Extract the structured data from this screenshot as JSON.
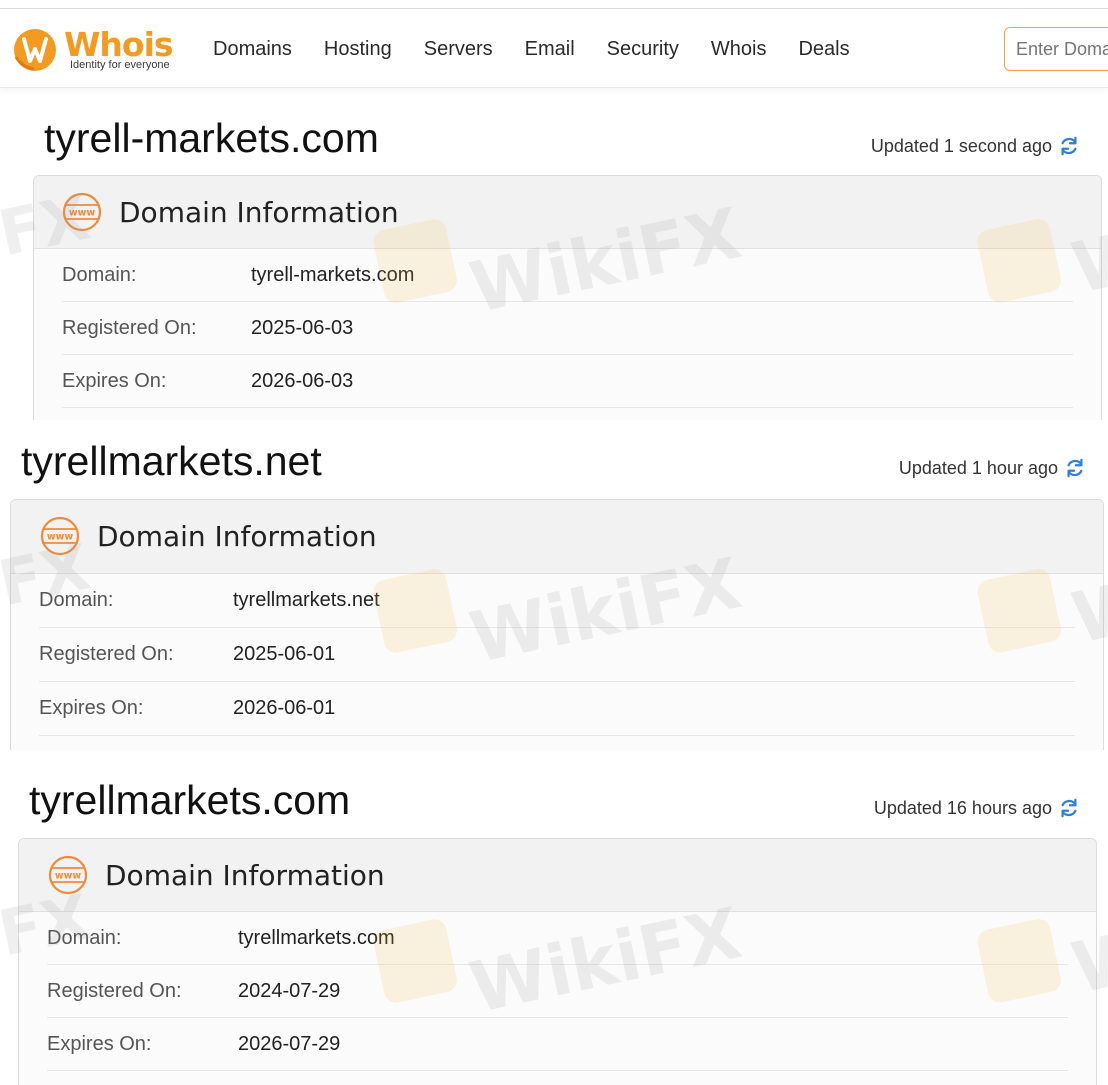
{
  "header": {
    "logo_word": "Whois",
    "logo_tagline": "Identity for everyone",
    "nav": [
      "Domains",
      "Hosting",
      "Servers",
      "Email",
      "Security",
      "Whois",
      "Deals"
    ],
    "search_placeholder": "Enter Domain"
  },
  "domains": [
    {
      "name": "tyrell-markets.com",
      "updated": "Updated 1 second ago",
      "card_title": "Domain Information",
      "rows": [
        {
          "label": "Domain:",
          "value": "tyrell-markets.com"
        },
        {
          "label": "Registered On:",
          "value": "2025-06-03"
        },
        {
          "label": "Expires On:",
          "value": "2026-06-03"
        }
      ]
    },
    {
      "name": "tyrellmarkets.net",
      "updated": "Updated 1 hour ago",
      "card_title": "Domain Information",
      "rows": [
        {
          "label": "Domain:",
          "value": "tyrellmarkets.net"
        },
        {
          "label": "Registered On:",
          "value": "2025-06-01"
        },
        {
          "label": "Expires On:",
          "value": "2026-06-01"
        }
      ]
    },
    {
      "name": "tyrellmarkets.com",
      "updated": "Updated 16 hours ago",
      "card_title": "Domain Information",
      "rows": [
        {
          "label": "Domain:",
          "value": "tyrellmarkets.com"
        },
        {
          "label": "Registered On:",
          "value": "2024-07-29"
        },
        {
          "label": "Expires On:",
          "value": "2026-07-29"
        }
      ]
    }
  ],
  "watermark": {
    "text": "WikiFX",
    "fragment_left": "FX",
    "fragment_right": "W"
  },
  "colors": {
    "brand_orange": "#f29a22",
    "refresh_blue": "#2f7fd6",
    "border": "#dcdcdc"
  }
}
